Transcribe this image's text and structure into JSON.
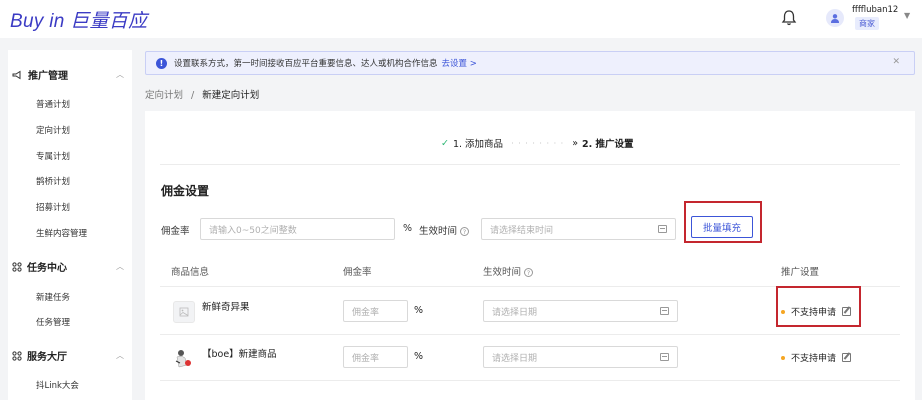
{
  "header": {
    "logo": "Buy in 巨量百应",
    "username": "ffffluban12",
    "role_badge": "商家"
  },
  "sidebar": {
    "groups": [
      {
        "label": "推广管理",
        "icon": "megaphone-icon",
        "items": [
          "普通计划",
          "定向计划",
          "专属计划",
          "鹊桥计划",
          "招募计划",
          "生鲜内容管理"
        ]
      },
      {
        "label": "任务中心",
        "icon": "grid-icon",
        "items": [
          "新建任务",
          "任务管理"
        ]
      },
      {
        "label": "服务大厅",
        "icon": "grid-icon",
        "items": [
          "抖Link大会"
        ]
      }
    ]
  },
  "notice": {
    "text": "设置联系方式，第一时间接收百应平台重要信息、达人或机构合作信息",
    "link": "去设置 >"
  },
  "breadcrumb": {
    "parent": "定向计划",
    "sep": "/",
    "current": "新建定向计划"
  },
  "steps": {
    "step1": "1. 添加商品",
    "step2": "2. 推广设置"
  },
  "commission": {
    "section_title": "佣金设置",
    "rate_label": "佣金率",
    "rate_placeholder": "请输入0~50之间整数",
    "percent": "%",
    "time_label": "生效时间",
    "time_placeholder": "请选择结束时间",
    "batch_button": "批量填充"
  },
  "table": {
    "headers": [
      "商品信息",
      "佣金率",
      "生效时间",
      "推广设置"
    ],
    "rows": [
      {
        "name": "新鲜奇异果",
        "rate_placeholder": "佣金率",
        "percent": "%",
        "date_placeholder": "请选择日期",
        "status": "不支持申请"
      },
      {
        "name": "【boe】新建商品",
        "rate_placeholder": "佣金率",
        "percent": "%",
        "date_placeholder": "请选择日期",
        "status": "不支持申请"
      }
    ]
  },
  "colors": {
    "brand": "#3b3bc4",
    "primary": "#3c55d8",
    "highlight_box": "#c4262e",
    "status_dot": "#f5a623"
  }
}
